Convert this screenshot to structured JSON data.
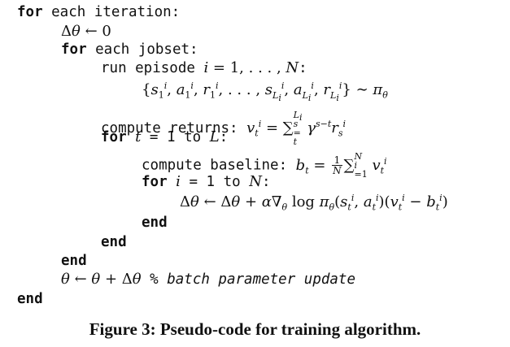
{
  "figure": {
    "caption": "Figure 3: Pseudo-code for training algorithm."
  },
  "code": {
    "kw_for": "for",
    "kw_end": "end",
    "each_iteration": " each iteration:",
    "each_jobset": " each jobset:",
    "run_episode": "run episode ",
    "compute_returns": "compute returns: ",
    "compute_baseline": "compute baseline: ",
    "t_range_mid": " = 1 to ",
    "i_range_mid": " = 1 to ",
    "comment": "% batch parameter update"
  }
}
